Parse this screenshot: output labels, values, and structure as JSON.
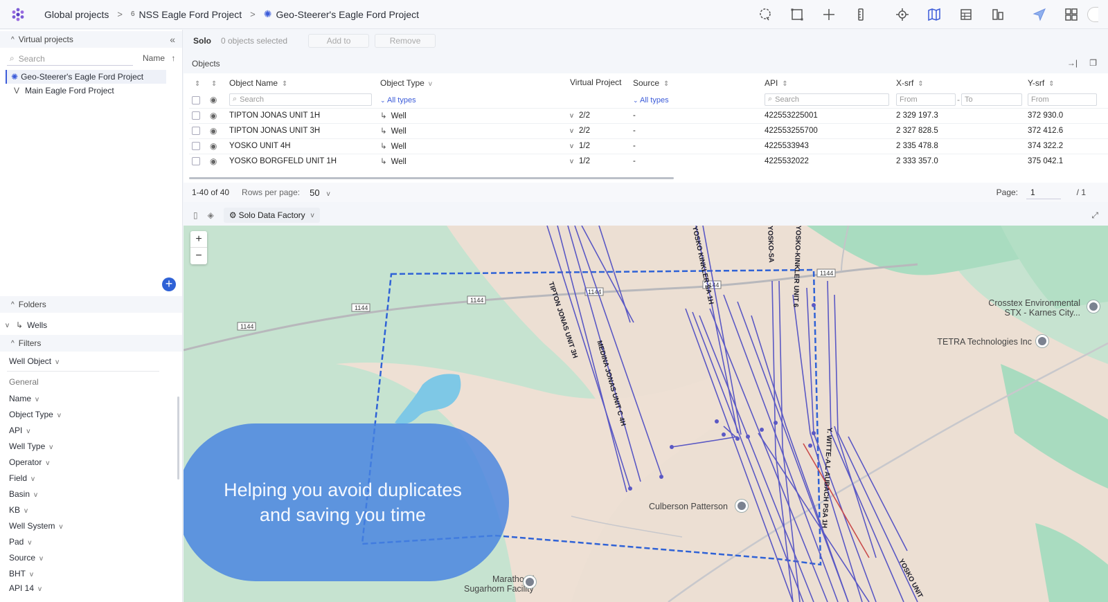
{
  "breadcrumb": {
    "global": "Global projects",
    "project": "NSS Eagle Ford Project",
    "project_prefix": "6",
    "current": "Geo-Steerer's Eagle Ford Project"
  },
  "left": {
    "virtual_projects_label": "Virtual projects",
    "search_placeholder": "Search",
    "sort_label": "Name",
    "projects": [
      {
        "name": "Geo-Steerer's Eagle Ford Project",
        "prefix": ""
      },
      {
        "name": "Main Eagle Ford Project",
        "prefix": "V"
      }
    ],
    "folders_label": "Folders",
    "wells_folder": "Wells",
    "filters_label": "Filters",
    "filter_object": "Well Object",
    "general_label": "General",
    "filters": [
      "Name",
      "Object Type",
      "API",
      "Well Type",
      "Operator",
      "Field",
      "Basin",
      "KB",
      "Well System",
      "Pad",
      "Source",
      "BHT",
      "API 14"
    ]
  },
  "solobar": {
    "solo": "Solo",
    "selected": "0 objects selected",
    "add": "Add to",
    "remove": "Remove"
  },
  "objects": {
    "title": "Objects",
    "columns": {
      "name": "Object Name",
      "type": "Object Type",
      "vp": "Virtual Project",
      "source": "Source",
      "api": "API",
      "xsrf": "X-srf",
      "ysrf": "Y-srf"
    },
    "filters": {
      "search": "Search",
      "all_types": "All types",
      "from": "From",
      "to": "To"
    },
    "rows": [
      {
        "name": "TIPTON JONAS UNIT 1H",
        "type": "Well",
        "vp": "2/2",
        "source": "-",
        "api": "422553225001",
        "x": "2 329 197.3",
        "y": "372 930.0"
      },
      {
        "name": "TIPTON JONAS UNIT 3H",
        "type": "Well",
        "vp": "2/2",
        "source": "-",
        "api": "422553255700",
        "x": "2 327 828.5",
        "y": "372 412.6"
      },
      {
        "name": "YOSKO UNIT 4H",
        "type": "Well",
        "vp": "1/2",
        "source": "-",
        "api": "4225533943",
        "x": "2 335 478.8",
        "y": "374 322.2"
      },
      {
        "name": "YOSKO BORGFELD UNIT 1H",
        "type": "Well",
        "vp": "1/2",
        "source": "-",
        "api": "4225532022",
        "x": "2 333 357.0",
        "y": "375 042.1"
      }
    ],
    "pager": {
      "range": "1-40 of 40",
      "rows_label": "Rows per page:",
      "rows_value": "50",
      "page_label": "Page:",
      "page_value": "1",
      "page_total": "/ 1"
    }
  },
  "map": {
    "datasource": "Solo Data Factory",
    "zoom_in": "+",
    "zoom_out": "−",
    "pois": {
      "crosstex_1": "Crosstex Environmental",
      "crosstex_2": "STX - Karnes City...",
      "tetra": "TETRA Technologies Inc",
      "culberson": "Culberson Patterson",
      "marathon_1": "Marathon /",
      "marathon_2": "Sugarhorn Facility"
    },
    "roads": [
      "1144",
      "1144",
      "1144",
      "1144",
      "1144",
      "1144"
    ],
    "well_labels": {
      "tipton": "TIPTON JONAS UNIT 3H",
      "medina": "MEDINA JONAS UNIT C 4H",
      "yosko_kinkler": "YOSKO KINKLER SA 1H",
      "yosko_sa": "YOSKO-SA",
      "yosko_kinkler6": "YOSKO-KINKLER UNIT 6",
      "witte": "Y. WITTE-A.L AUBACH PSA 1H",
      "yosko_unit": "YOSKO UNIT"
    },
    "bubble_text": "Helping you avoid duplicates and saving you time"
  }
}
